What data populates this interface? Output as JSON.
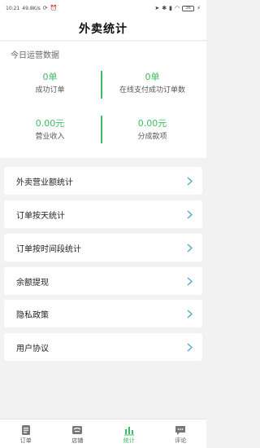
{
  "status_bar": {
    "time": "10:21",
    "network_speed": "49.8K/s",
    "battery": "36"
  },
  "header": {
    "title": "外卖统计"
  },
  "today_stats": {
    "section_title": "今日运营数据",
    "items": [
      {
        "value": "0单",
        "label": "成功订单"
      },
      {
        "value": "0单",
        "label": "在线支付成功订单数"
      },
      {
        "value": "0.00元",
        "label": "营业收入"
      },
      {
        "value": "0.00元",
        "label": "分成款项"
      }
    ]
  },
  "menu": {
    "items": [
      {
        "label": "外卖营业额统计"
      },
      {
        "label": "订单按天统计"
      },
      {
        "label": "订单按时间段统计"
      },
      {
        "label": "余额提现"
      },
      {
        "label": "隐私政策"
      },
      {
        "label": "用户协议"
      }
    ]
  },
  "tabbar": {
    "tabs": [
      {
        "label": "订单",
        "icon": "order-icon"
      },
      {
        "label": "店铺",
        "icon": "store-icon"
      },
      {
        "label": "统计",
        "icon": "chart-icon",
        "active": true
      },
      {
        "label": "评论",
        "icon": "comment-icon"
      }
    ]
  },
  "colors": {
    "accent": "#3dbb63",
    "background": "#f2f2f2",
    "chevron": "#4aa8c8"
  }
}
